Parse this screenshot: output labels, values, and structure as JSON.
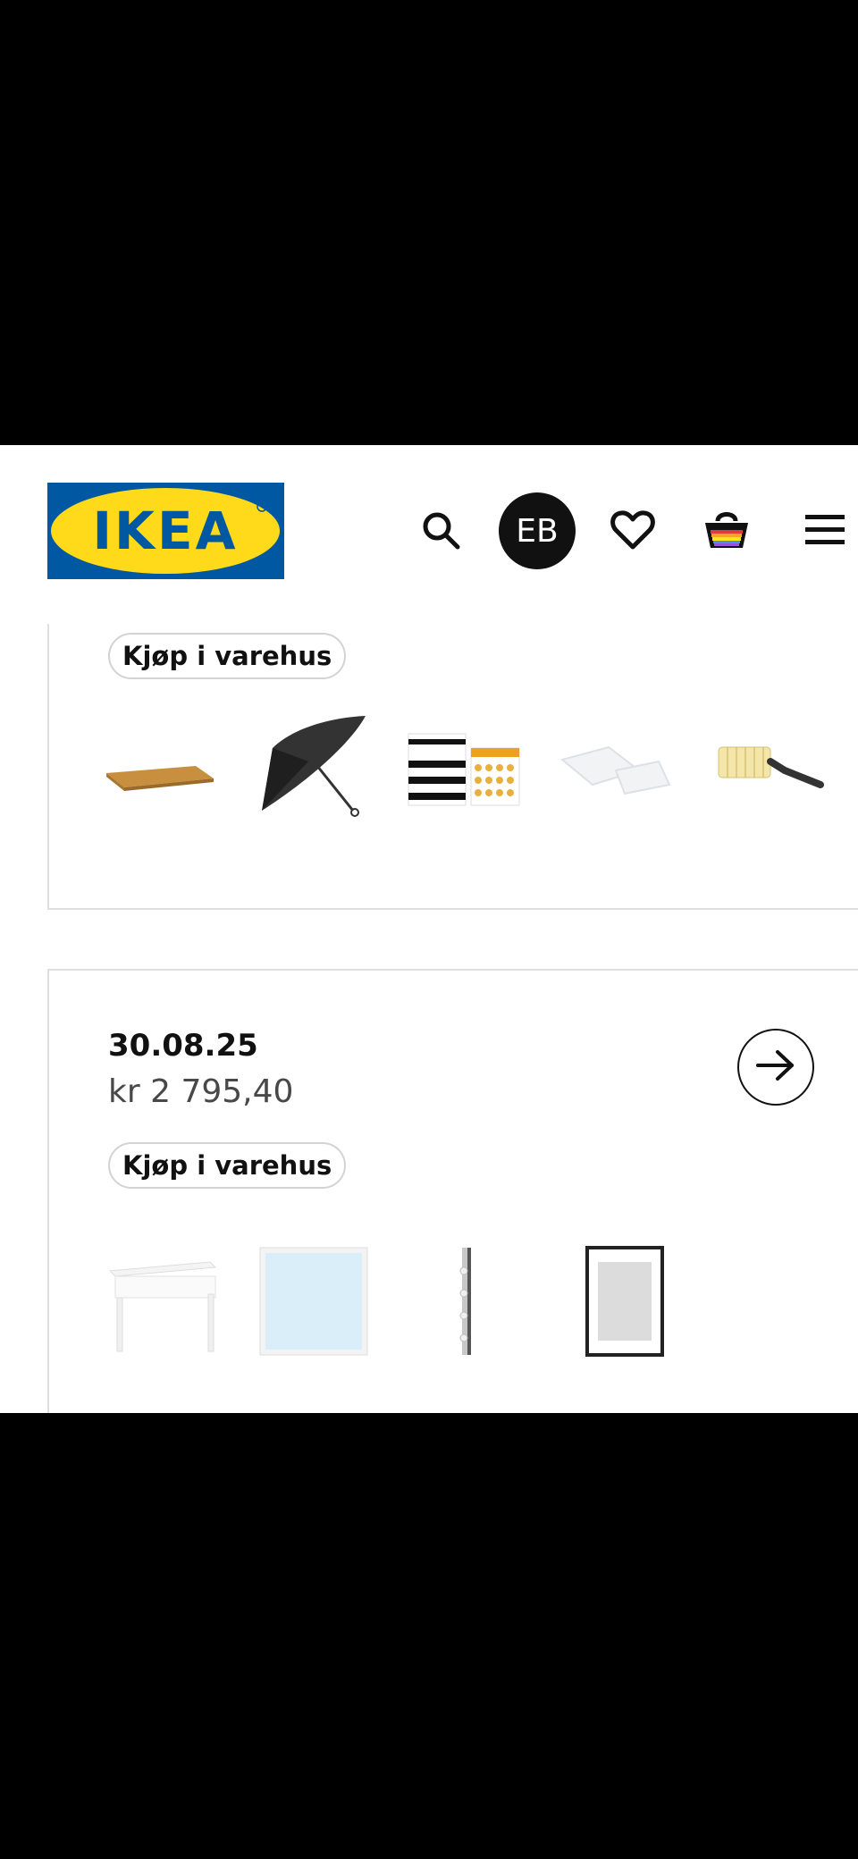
{
  "header": {
    "logo_text": "IKEA",
    "avatar_initials": "EB",
    "icons": [
      "search-icon",
      "heart-icon",
      "basket-icon",
      "menu-icon"
    ]
  },
  "orders": [
    {
      "badge": "Kjøp i varehus",
      "products": [
        "wooden-board",
        "umbrella",
        "sticker-sheets",
        "clear-bags",
        "lint-roller"
      ]
    },
    {
      "date": "30.08.25",
      "price": "kr 2 795,40",
      "badge": "Kjøp i varehus",
      "products": [
        "white-desk",
        "mirror",
        "wall-hook-rack",
        "black-frame"
      ]
    }
  ],
  "colors": {
    "ikea_blue": "#0058a3",
    "ikea_yellow": "#ffda1a"
  }
}
